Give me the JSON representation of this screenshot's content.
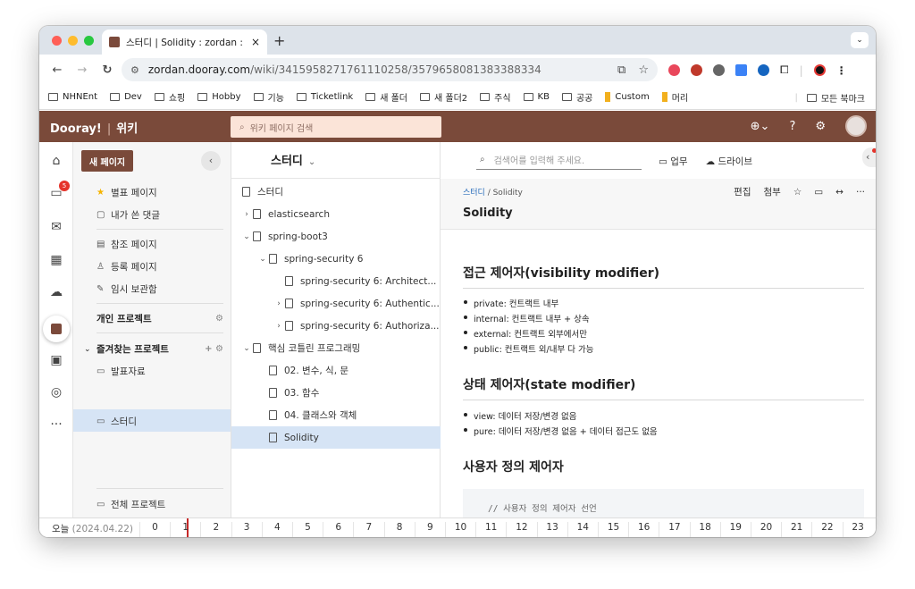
{
  "browser": {
    "tab_title": "스터디 | Solidity : zordan : Doo",
    "tab_close": "×",
    "new_tab": "+",
    "url_host": "zordan.dooray.com",
    "url_path": "/wiki/3415958271761110258/3579658081383388334",
    "bookmarks": [
      "NHNEnt",
      "Dev",
      "쇼핑",
      "Hobby",
      "기능",
      "Ticketlink",
      "새 폴더",
      "새 폴더2",
      "주식",
      "KB",
      "공공",
      "Custom",
      "머리"
    ],
    "all_bookmarks": "모든 북마크"
  },
  "app": {
    "brand": "Dooray!",
    "section": "위키",
    "search_placeholder": "위키 페이지 검색"
  },
  "sidebar": {
    "new_page": "새 페이지",
    "collapse": "‹",
    "items": [
      "별표 페이지",
      "내가 쓴 댓글",
      "참조 페이지",
      "등록 페이지",
      "임시 보관함"
    ],
    "personal_project": "개인 프로젝트",
    "favorites_header": "즐겨찾는 프로젝트",
    "favorites": [
      "발표자료",
      "스터디"
    ],
    "all_projects": "전체 프로젝트"
  },
  "rail": {
    "badge": "5",
    "more": "···"
  },
  "tree": {
    "title": "스터디",
    "dropdown": "⌄",
    "rows": [
      {
        "label": "스터디",
        "chev": ""
      },
      {
        "label": "elasticsearch",
        "chev": "›"
      },
      {
        "label": "spring-boot3",
        "chev": "⌄"
      },
      {
        "label": "spring-security 6",
        "chev": "⌄"
      },
      {
        "label": "spring-security 6: Architect...",
        "chev": ""
      },
      {
        "label": "spring-security 6: Authentic...",
        "chev": "›"
      },
      {
        "label": "spring-security 6: Authoriza...",
        "chev": "›"
      },
      {
        "label": "핵심 코틀린 프로그래밍",
        "chev": "⌄"
      },
      {
        "label": "02. 변수, 식, 문",
        "chev": ""
      },
      {
        "label": "03. 함수",
        "chev": ""
      },
      {
        "label": "04. 클래스와 객체",
        "chev": ""
      },
      {
        "label": "Solidity",
        "chev": ""
      }
    ]
  },
  "content": {
    "search_placeholder": "검색어를 입력해 주세요.",
    "link_tasks": "업무",
    "link_drive": "드라이브",
    "breadcrumb_parent": "스터디",
    "breadcrumb_current": " / Solidity",
    "title": "Solidity",
    "tool_edit": "편집",
    "tool_attach": "첨부",
    "sections": [
      {
        "heading": "접근 제어자(visibility modifier)",
        "items": [
          "private: 컨트랙트 내부",
          "internal: 컨트랙트 내부 + 상속",
          "external: 컨트랙트 외부에서만",
          "public: 컨트랙트 외/내부 다 가능"
        ]
      },
      {
        "heading": "상태 제어자(state modifier)",
        "items": [
          "view: 데이터 저장/변경 없음",
          "pure: 데이터 저장/변경 없음 + 데이터 접근도 없음"
        ]
      },
      {
        "heading": "사용자 정의 제어자",
        "items": []
      }
    ],
    "code_comment": "// 사용자 정의 제어자 선언"
  },
  "timeline": {
    "today": "오늘",
    "date": "(2024.04.22)",
    "hours": [
      "0",
      "1",
      "2",
      "3",
      "4",
      "5",
      "6",
      "7",
      "8",
      "9",
      "10",
      "11",
      "12",
      "13",
      "14",
      "15",
      "16",
      "17",
      "18",
      "19",
      "20",
      "21",
      "22",
      "23"
    ]
  }
}
